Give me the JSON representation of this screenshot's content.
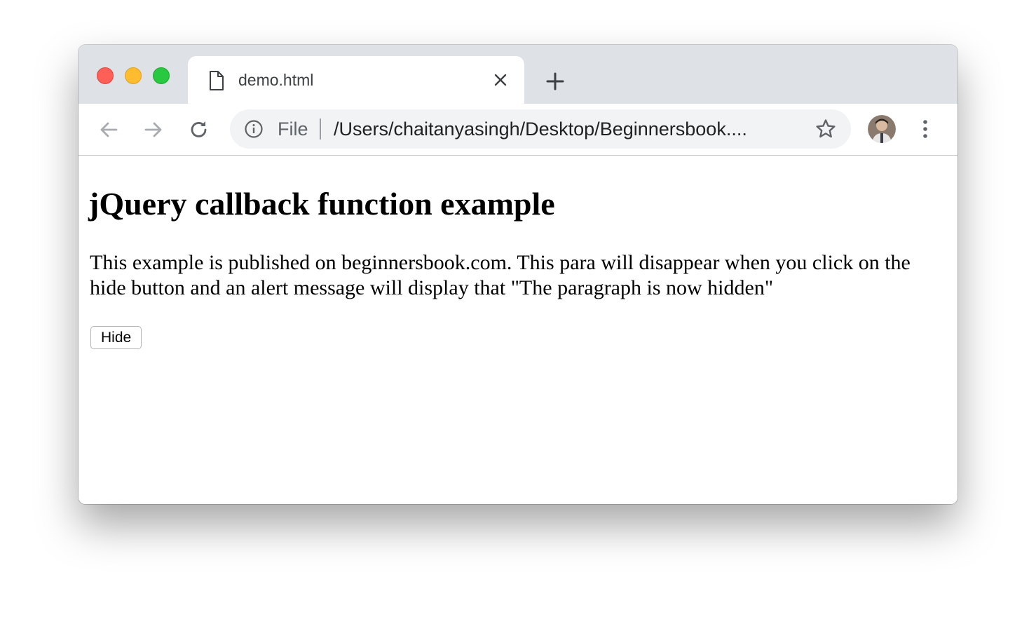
{
  "browser": {
    "tab": {
      "title": "demo.html",
      "icon": "document-icon"
    },
    "toolbar": {
      "scheme_label": "File",
      "url": "/Users/chaitanyasingh/Desktop/Beginnersbook....",
      "icons": [
        "back-arrow-icon",
        "forward-arrow-icon",
        "reload-icon",
        "info-icon",
        "star-icon",
        "avatar",
        "more-menu-icon"
      ]
    },
    "colors": {
      "titlebar": "#dee1e6",
      "omnibox": "#f1f3f4",
      "close": "#fe5f57",
      "minimize": "#febc2e",
      "zoom": "#28c840"
    }
  },
  "page": {
    "heading": "jQuery callback function example",
    "paragraph": "This example is published on beginnersbook.com. This para will disappear when you click on the hide button and an alert message will display that \"The paragraph is now hidden\"",
    "button_label": "Hide"
  }
}
